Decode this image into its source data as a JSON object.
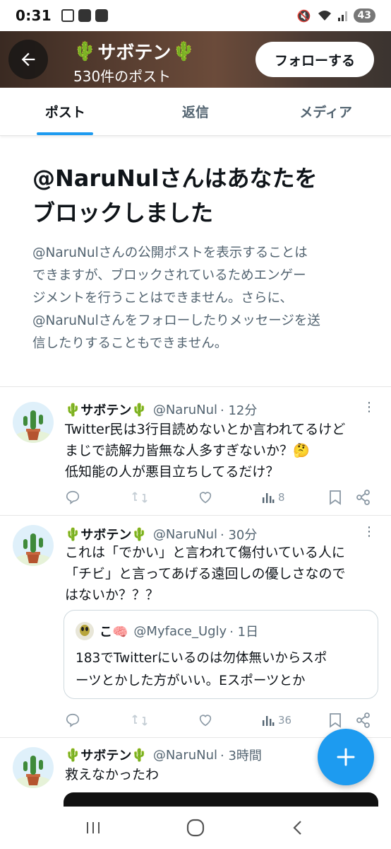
{
  "status_bar": {
    "time": "0:31",
    "battery": "43"
  },
  "header": {
    "title": "サボテン",
    "post_count": "530件のポスト",
    "follow_label": "フォローする"
  },
  "tabs": [
    {
      "label": "ポスト",
      "active": true
    },
    {
      "label": "返信",
      "active": false
    },
    {
      "label": "メディア",
      "active": false
    }
  ],
  "blocked": {
    "title_line1": "@NaruNulさんはあなたを",
    "title_line2": "ブロックしました",
    "body_line1": "@NaruNulさんの公開ポストを表示することは",
    "body_line2": "できますが、ブロックされているためエンゲー",
    "body_line3": "ジメントを行うことはできません。さらに、",
    "body_line4": "@NaruNulさんをフォローしたりメッセージを送",
    "body_line5": "信したりすることもできません。"
  },
  "posts": [
    {
      "name": "サボテン",
      "handle": "@NaruNul",
      "time": "· 12分",
      "line1": "Twitter民は3行目読めないとか言われてるけど",
      "line2": "まじで読解力皆無な人多すぎないか？🤔",
      "line3": "低知能の人が悪目立ちしてるだけ？",
      "views": "8"
    },
    {
      "name": "サボテン",
      "handle": "@NaruNul",
      "time": "· 30分",
      "line1": "これは「でかい」と言われて傷付いている人に",
      "line2": "「チビ」と言ってあげる遠回しの優しさなので",
      "line3": "はないか？？？",
      "views": "36",
      "quote": {
        "name": "こ🧠",
        "handle": "@Myface_Ugly",
        "time": "· 1日",
        "line1": "183でTwitterにいるのは勿体無いからスポ",
        "line2": "ーツとかした方がいい。Eスポーツとか"
      }
    },
    {
      "name": "サボテン",
      "handle": "@NaruNul",
      "time": "· 3時間",
      "line1": "救えなかったわ"
    }
  ],
  "colors": {
    "accent": "#1d9bf0",
    "secondary_text": "#536471",
    "icon_gray": "#8a98a4"
  }
}
